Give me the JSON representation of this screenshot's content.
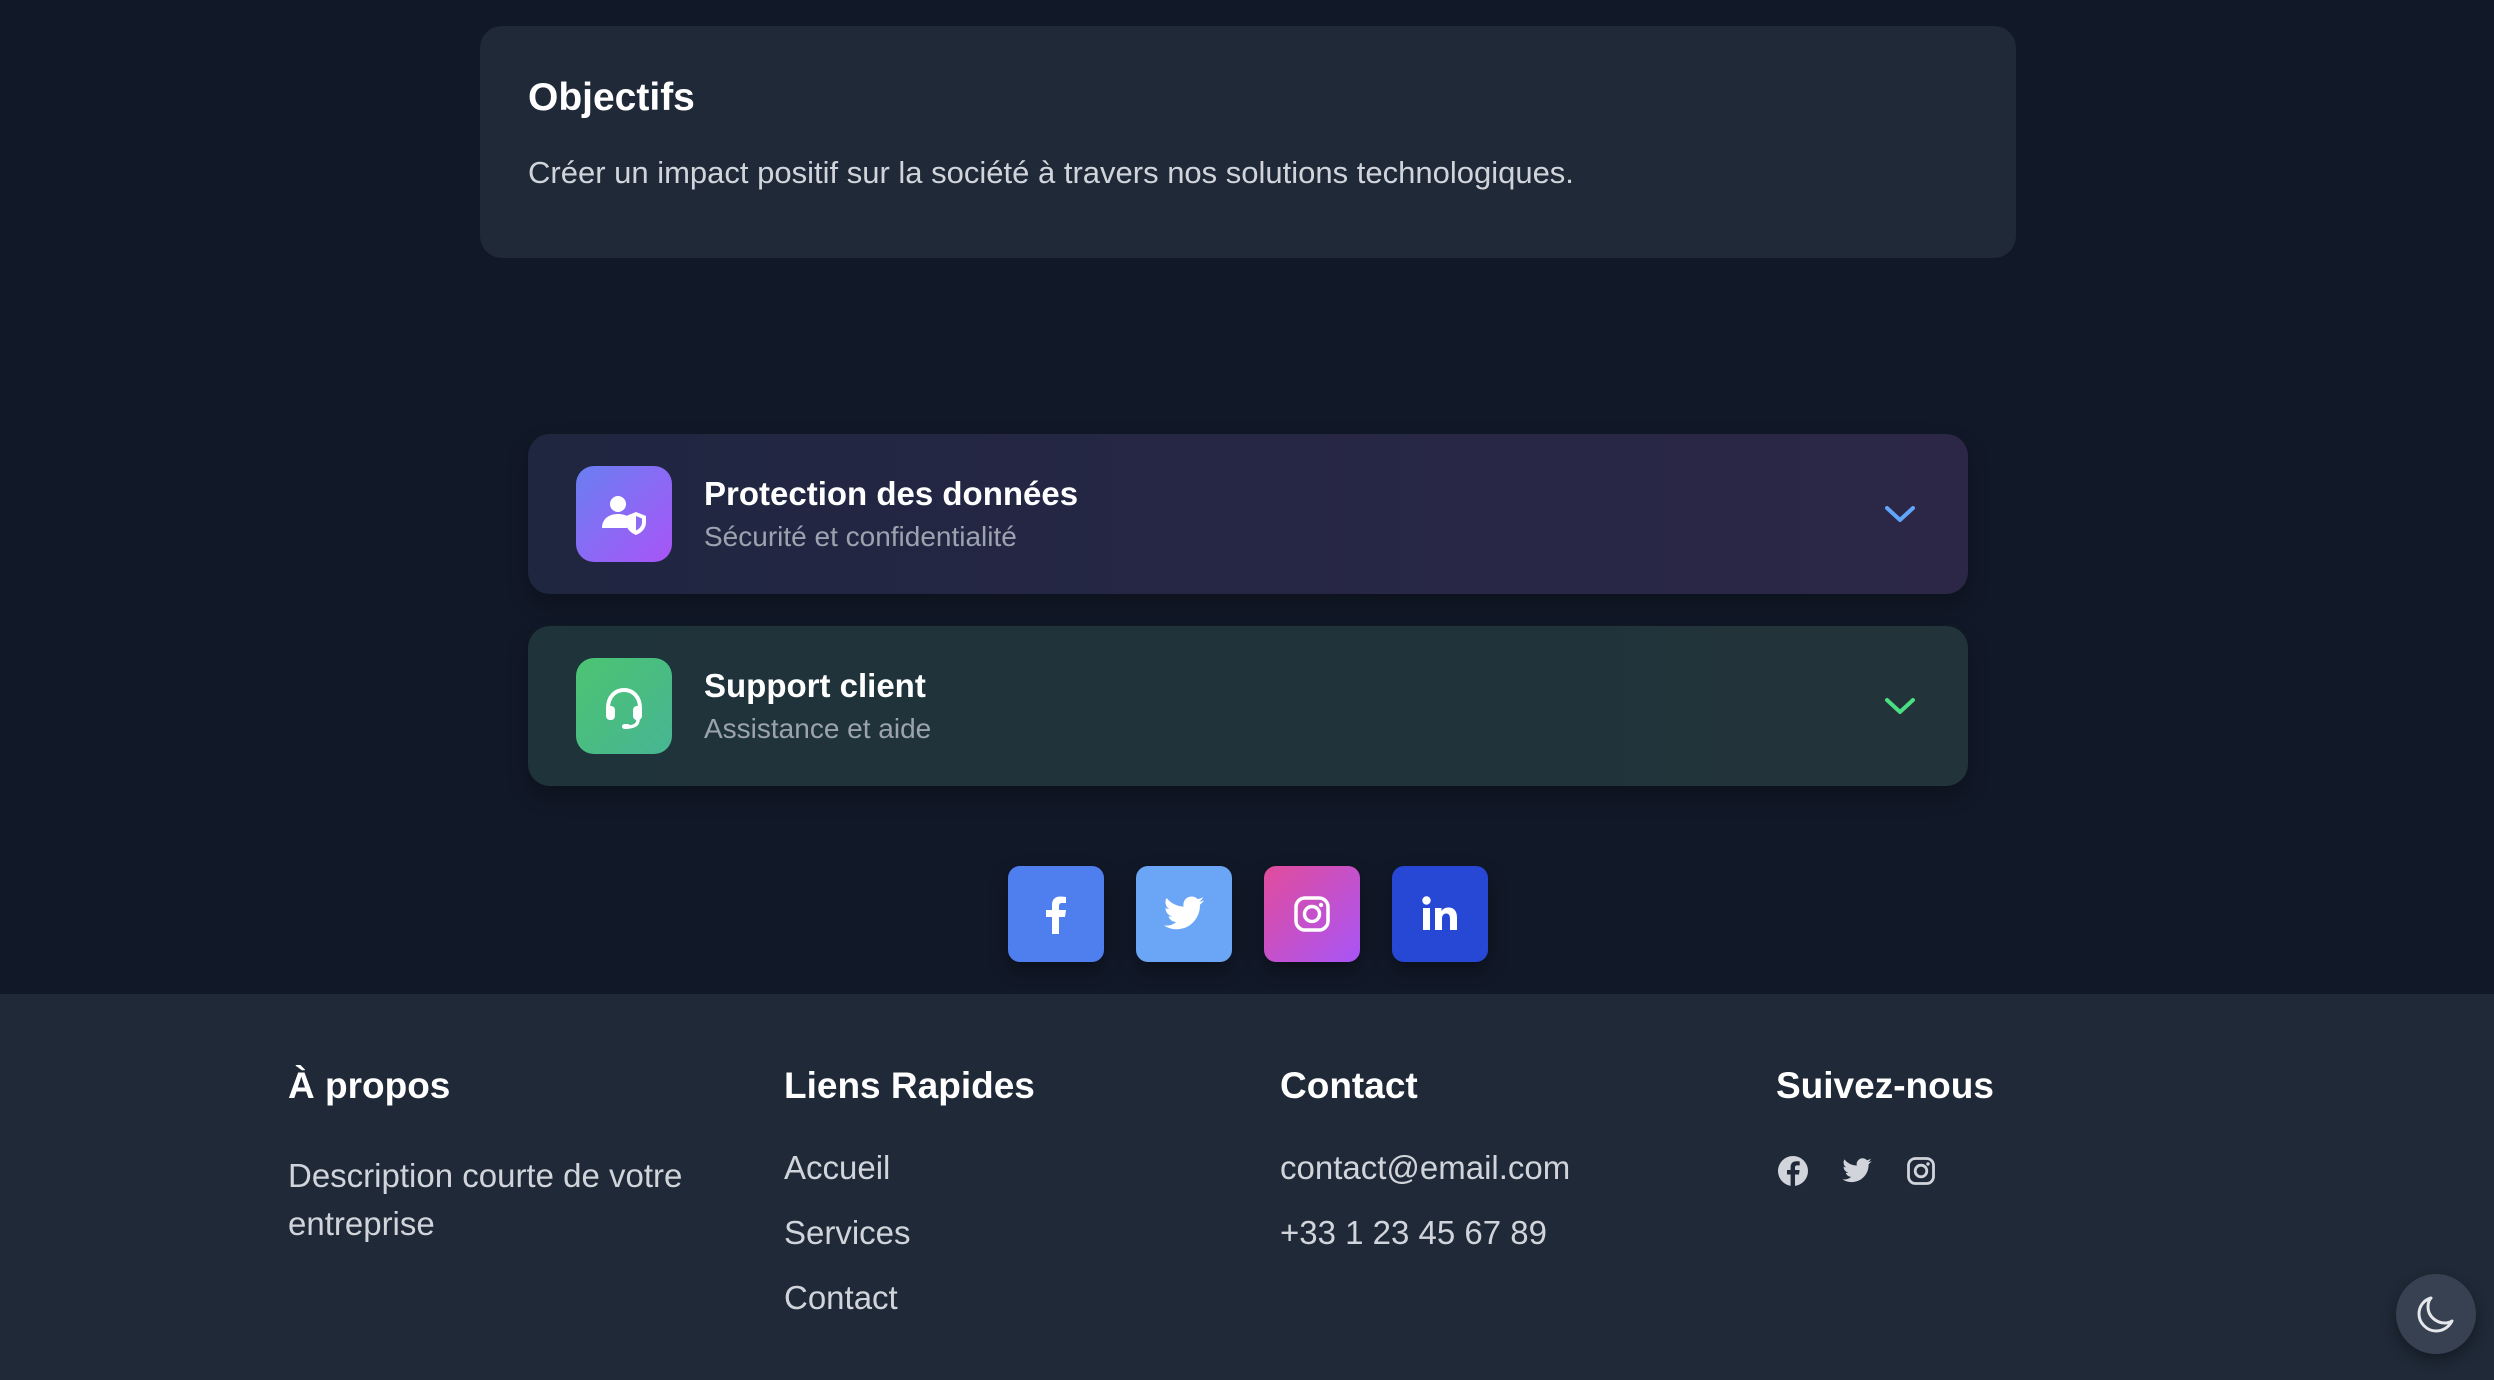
{
  "objectives": {
    "title": "Objectifs",
    "text": "Créer un impact positif sur la société à travers nos solutions technologiques."
  },
  "accordions": [
    {
      "title": "Protection des données",
      "subtitle": "Sécurité et confidentialité",
      "icon": "user-shield-icon",
      "accent": "#60a5fa"
    },
    {
      "title": "Support client",
      "subtitle": "Assistance et aide",
      "icon": "headset-icon",
      "accent": "#4ade80"
    }
  ],
  "social_buttons": [
    {
      "name": "facebook",
      "icon": "facebook-icon",
      "color": "#4f7fef"
    },
    {
      "name": "twitter",
      "icon": "twitter-icon",
      "color": "#6aa6f5"
    },
    {
      "name": "instagram",
      "icon": "instagram-icon",
      "color": "#c04fd0"
    },
    {
      "name": "linkedin",
      "icon": "linkedin-icon",
      "color": "#2648d4"
    }
  ],
  "footer": {
    "about": {
      "heading": "À propos",
      "text": "Description courte de votre entreprise"
    },
    "quick_links": {
      "heading": "Liens Rapides",
      "links": [
        "Accueil",
        "Services",
        "Contact"
      ]
    },
    "contact": {
      "heading": "Contact",
      "email": "contact@email.com",
      "phone": "+33 1 23 45 67 89"
    },
    "follow": {
      "heading": "Suivez-nous",
      "icons": [
        "facebook-icon",
        "twitter-icon",
        "instagram-icon"
      ]
    }
  },
  "theme_toggle": {
    "icon": "moon-icon"
  },
  "colors": {
    "background": "#111827",
    "card": "#1f2937",
    "text": "#d1d5db"
  }
}
